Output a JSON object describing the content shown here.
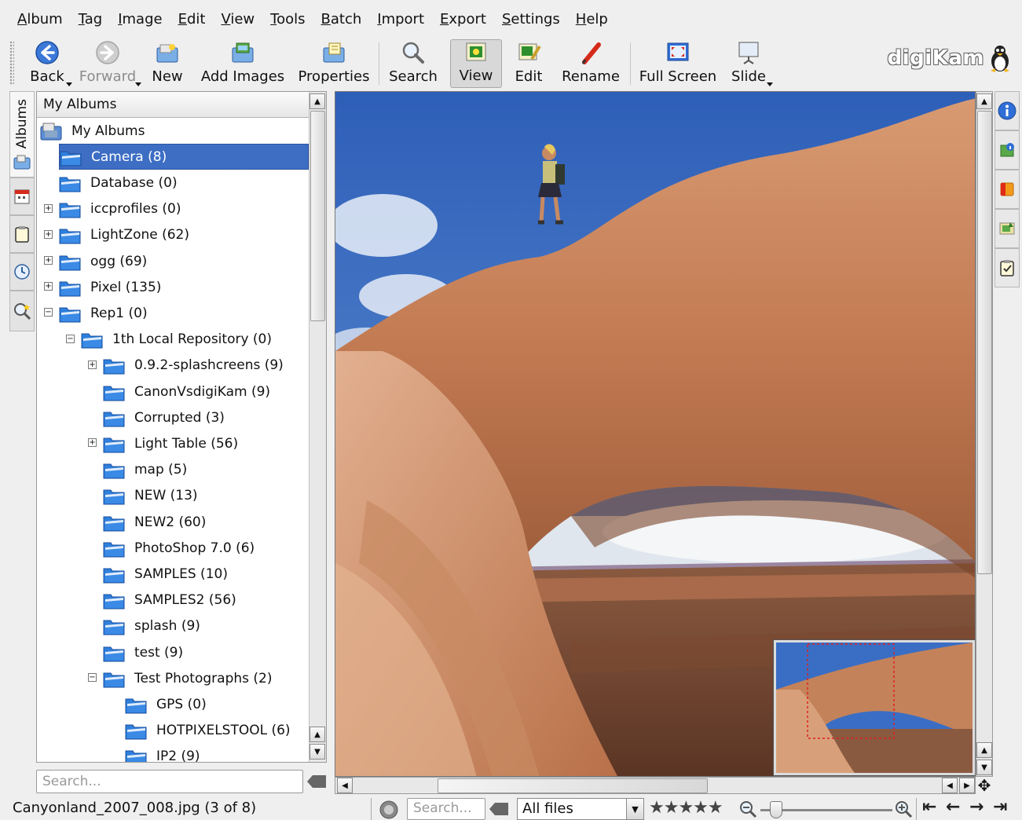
{
  "menu": [
    {
      "key": "A",
      "rest": "lbum"
    },
    {
      "key": "T",
      "rest": "ag"
    },
    {
      "key": "I",
      "rest": "mage"
    },
    {
      "key": "E",
      "rest": "dit"
    },
    {
      "key": "V",
      "rest": "iew"
    },
    {
      "key": "T",
      "rest": "ools"
    },
    {
      "key": "B",
      "rest": "atch"
    },
    {
      "key": "I",
      "rest": "mport"
    },
    {
      "key": "E",
      "rest": "xport"
    },
    {
      "key": "S",
      "rest": "ettings"
    },
    {
      "key": "H",
      "rest": "elp"
    }
  ],
  "toolbar": {
    "back": "Back",
    "forward": "Forward",
    "new": "New",
    "add_images": "Add Images",
    "properties": "Properties",
    "search": "Search",
    "view": "View",
    "edit": "Edit",
    "rename": "Rename",
    "full_screen": "Full Screen",
    "slide": "Slide"
  },
  "logo": "digiKam",
  "left_tabs": {
    "albums": "Albums"
  },
  "album_panel": {
    "header": "My Albums",
    "search_placeholder": "Search...",
    "tree": [
      {
        "label": "My Albums",
        "level": 0,
        "expander": "",
        "selected": false,
        "root": true
      },
      {
        "label": "Camera (8)",
        "level": 1,
        "expander": "",
        "selected": true
      },
      {
        "label": "Database (0)",
        "level": 1,
        "expander": "",
        "selected": false
      },
      {
        "label": "iccprofiles (0)",
        "level": 1,
        "expander": "+",
        "selected": false
      },
      {
        "label": "LightZone (62)",
        "level": 1,
        "expander": "+",
        "selected": false
      },
      {
        "label": "ogg (69)",
        "level": 1,
        "expander": "+",
        "selected": false
      },
      {
        "label": "Pixel (135)",
        "level": 1,
        "expander": "+",
        "selected": false
      },
      {
        "label": "Rep1 (0)",
        "level": 1,
        "expander": "−",
        "selected": false
      },
      {
        "label": "1th Local Repository (0)",
        "level": 2,
        "expander": "−",
        "selected": false
      },
      {
        "label": "0.9.2-splashcreens (9)",
        "level": 3,
        "expander": "+",
        "selected": false
      },
      {
        "label": "CanonVsdigiKam (9)",
        "level": 3,
        "expander": "",
        "selected": false
      },
      {
        "label": "Corrupted (3)",
        "level": 3,
        "expander": "",
        "selected": false
      },
      {
        "label": "Light Table (56)",
        "level": 3,
        "expander": "+",
        "selected": false
      },
      {
        "label": "map (5)",
        "level": 3,
        "expander": "",
        "selected": false
      },
      {
        "label": "NEW (13)",
        "level": 3,
        "expander": "",
        "selected": false
      },
      {
        "label": "NEW2 (60)",
        "level": 3,
        "expander": "",
        "selected": false
      },
      {
        "label": "PhotoShop 7.0 (6)",
        "level": 3,
        "expander": "",
        "selected": false
      },
      {
        "label": "SAMPLES (10)",
        "level": 3,
        "expander": "",
        "selected": false
      },
      {
        "label": "SAMPLES2 (56)",
        "level": 3,
        "expander": "",
        "selected": false
      },
      {
        "label": "splash (9)",
        "level": 3,
        "expander": "",
        "selected": false
      },
      {
        "label": "test (9)",
        "level": 3,
        "expander": "",
        "selected": false
      },
      {
        "label": "Test Photographs (2)",
        "level": 3,
        "expander": "−",
        "selected": false
      },
      {
        "label": "GPS (0)",
        "level": 4,
        "expander": "",
        "selected": false
      },
      {
        "label": "HOTPIXELSTOOL (6)",
        "level": 4,
        "expander": "",
        "selected": false
      },
      {
        "label": "IP2 (9)",
        "level": 4,
        "expander": "",
        "selected": false
      }
    ]
  },
  "status": {
    "filename": "Canyonland_2007_008.jpg (3 of 8)",
    "search_placeholder": "Search...",
    "filter": "All files",
    "rating": "★★★★★"
  },
  "colors": {
    "selection": "#3d6ec4",
    "folder_blue": "#2f7fdc",
    "sky": "#3f73c8",
    "rock": "#c8794e"
  }
}
